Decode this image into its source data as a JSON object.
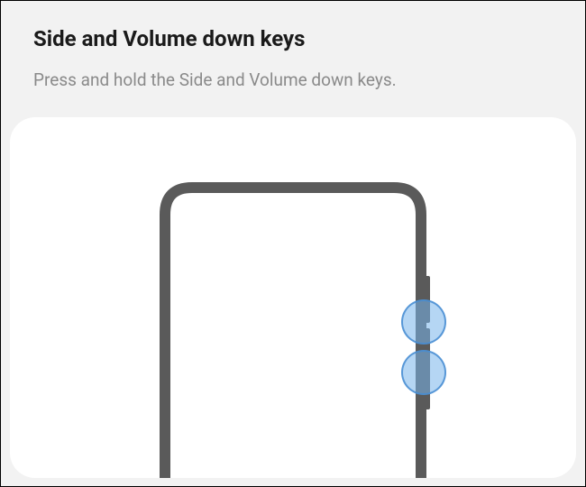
{
  "header": {
    "title": "Side and Volume down keys",
    "subtitle": "Press and hold the Side and Volume down keys."
  },
  "illustration": {
    "name": "phone-side-volume-keys-diagram",
    "highlight_upper": "volume-down-key-highlight",
    "highlight_lower": "side-key-highlight"
  }
}
